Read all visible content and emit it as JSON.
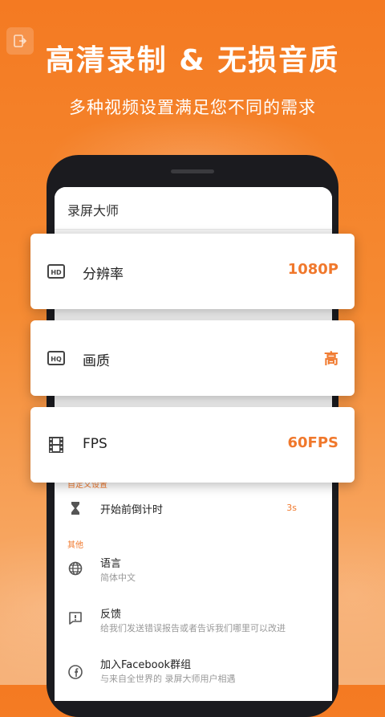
{
  "hero": {
    "title": "高清录制 & 无损音质",
    "subtitle": "多种视频设置满足您不同的需求"
  },
  "app": {
    "title": "录屏大师"
  },
  "cards": [
    {
      "label": "分辨率",
      "value": "1080P",
      "icon": "hd-icon"
    },
    {
      "label": "画质",
      "value": "高",
      "icon": "hq-icon"
    },
    {
      "label": "FPS",
      "value": "60FPS",
      "icon": "film-icon"
    }
  ],
  "settings": {
    "custom_section": "自定义设置",
    "countdown": {
      "title": "开始前倒计时",
      "value": "3s"
    },
    "other_section": "其他",
    "language": {
      "title": "语言",
      "subtitle": "简体中文"
    },
    "feedback": {
      "title": "反馈",
      "subtitle": "给我们发送错误报告或者告诉我们哪里可以改进"
    },
    "facebook": {
      "title": "加入Facebook群组",
      "subtitle": "与来自全世界的 录屏大师用户相遇"
    }
  },
  "colors": {
    "accent": "#f0782c",
    "background_top": "#f47a22",
    "phone_frame": "#1b1b1f"
  }
}
